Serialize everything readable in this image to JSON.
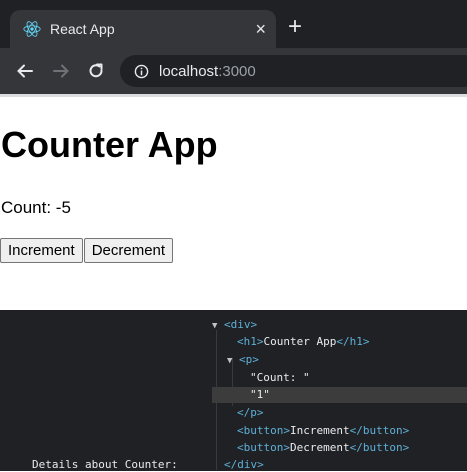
{
  "browser": {
    "tab": {
      "title": "React App",
      "close_glyph": "×",
      "favicon": "react-logo-icon"
    },
    "new_tab_glyph": "+",
    "address": {
      "host": "localhost",
      "port": ":3000"
    }
  },
  "page": {
    "title": "Counter App",
    "count_text": "Count: -5",
    "increment_label": "Increment",
    "decrement_label": "Decrement"
  },
  "devtools": {
    "details_label": "Details about Counter:",
    "lines": {
      "div_open": "<div>",
      "h1_open": "<h1>",
      "h1_text": "Counter App",
      "h1_close": "</h1>",
      "p_open": "<p>",
      "count_string": "\"Count: \"",
      "count_value": "\"1\"",
      "p_close": "</p>",
      "button_open": "<button>",
      "increment_text": "Increment",
      "button_close": "</button>",
      "decrement_text": "Decrement",
      "div_close": "</div>"
    }
  },
  "colors": {
    "chrome_bg": "#202124",
    "toolbar_bg": "#35363a",
    "devtools_tag": "#5db0d7",
    "devtools_text": "#e8eaed"
  }
}
